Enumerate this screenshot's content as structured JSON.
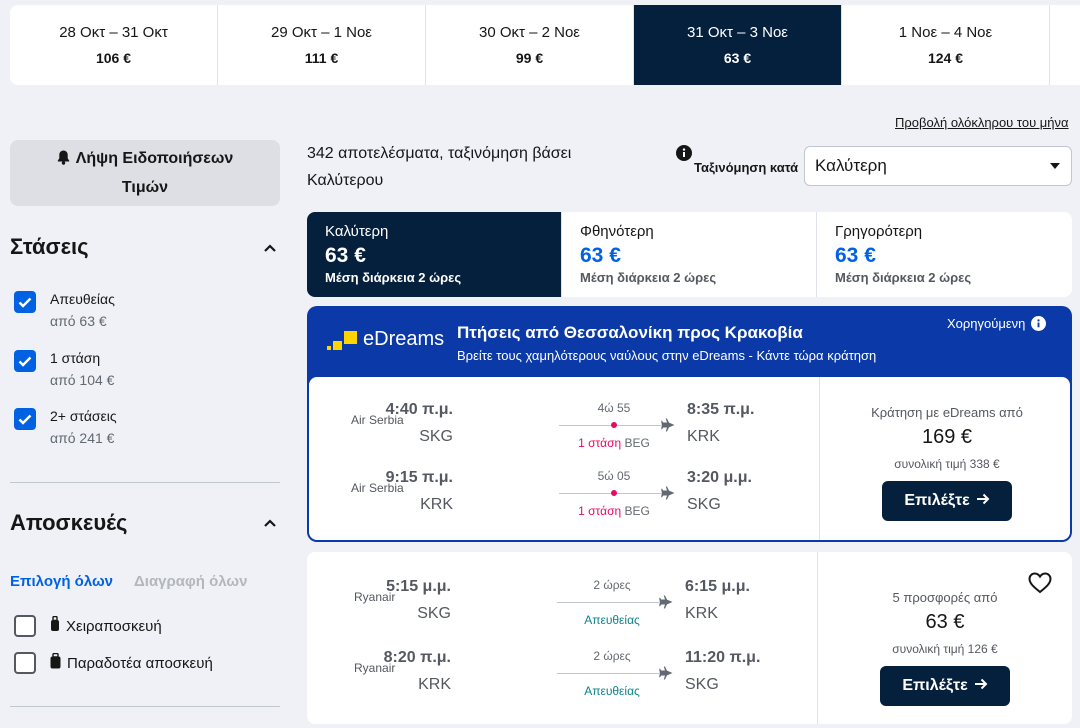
{
  "date_strip": [
    {
      "range": "28 Οκτ – 31 Οκτ",
      "price": "106 €"
    },
    {
      "range": "29 Οκτ – 1 Νοε",
      "price": "111 €"
    },
    {
      "range": "30 Οκτ – 2 Νοε",
      "price": "99 €"
    },
    {
      "range": "31 Οκτ – 3 Νοε",
      "price": "63 €"
    },
    {
      "range": "1 Νοε – 4 Νοε",
      "price": "124 €"
    }
  ],
  "month_link": "Προβολή ολόκληρου του μήνα",
  "sidebar": {
    "alert_line1": "Λήψη Ειδοποιήσεων",
    "alert_line2": "Τιμών",
    "stops_title": "Στάσεις",
    "stops": [
      {
        "label": "Απευθείας",
        "sub": "από 63 €"
      },
      {
        "label": "1 στάση",
        "sub": "από 104 €"
      },
      {
        "label": "2+ στάσεις",
        "sub": "από 241 €"
      }
    ],
    "bags_title": "Αποσκευές",
    "select_all": "Επιλογή όλων",
    "clear_all": "Διαγραφή όλων",
    "bags": [
      "Χειραποσκευή",
      "Παραδοτέα αποσκευή"
    ]
  },
  "results": {
    "count_line1": "342 αποτελέσματα, ταξινόμηση βάσει",
    "count_line2": "Καλύτερου",
    "sort_label": "Ταξινόμηση κατά",
    "sort_value": "Καλύτερη"
  },
  "sort_tabs": [
    {
      "title": "Καλύτερη",
      "price": "63 €",
      "duration": "Μέση διάρκεια 2 ώρες"
    },
    {
      "title": "Φθηνότερη",
      "price": "63 €",
      "duration": "Μέση διάρκεια 2 ώρες"
    },
    {
      "title": "Γρηγορότερη",
      "price": "63 €",
      "duration": "Μέση διάρκεια 2 ώρες"
    }
  ],
  "sponsored": {
    "brand": "eDreams",
    "title": "Πτήσεις από Θεσσαλονίκη προς Κρακοβία",
    "subtitle": "Βρείτε τους χαμηλότερους ναύλους στην eDreams - Κάντε τώρα κράτηση",
    "tag": "Χορηγούμενη",
    "legs": [
      {
        "airline": "Air Serbia",
        "dep_time": "4:40 π.μ.",
        "dep_airport": "SKG",
        "duration": "4ώ 55",
        "stops": "1 στάση",
        "via": "BEG",
        "arr_time": "8:35 π.μ.",
        "arr_airport": "KRK"
      },
      {
        "airline": "Air Serbia",
        "dep_time": "9:15 π.μ.",
        "dep_airport": "KRK",
        "duration": "5ώ 05",
        "stops": "1 στάση",
        "via": "BEG",
        "arr_time": "3:20 μ.μ.",
        "arr_airport": "SKG"
      }
    ],
    "price_label": "Κράτηση με eDreams από",
    "price": "169 €",
    "total": "συνολική τιμή 338 €",
    "button": "Επιλέξτε"
  },
  "result_card": {
    "legs": [
      {
        "airline": "Ryanair",
        "dep_time": "5:15 μ.μ.",
        "dep_airport": "SKG",
        "duration": "2 ώρες",
        "stops": "Απευθείας",
        "arr_time": "6:15 μ.μ.",
        "arr_airport": "KRK"
      },
      {
        "airline": "Ryanair",
        "dep_time": "8:20 π.μ.",
        "dep_airport": "KRK",
        "duration": "2 ώρες",
        "stops": "Απευθείας",
        "arr_time": "11:20 π.μ.",
        "arr_airport": "SKG"
      }
    ],
    "price_label": "5 προσφορές από",
    "price": "63 €",
    "total": "συνολική τιμή 126 €",
    "button": "Επιλέξτε"
  },
  "icons": {
    "bell": "bell-icon",
    "chevron": "chevron-up-icon",
    "info": "info-icon",
    "plane": "plane-icon",
    "heart": "heart-icon",
    "arrow": "arrow-right-icon",
    "bag": "luggage-icon"
  },
  "colors": {
    "primary_dark": "#05203c",
    "accent_blue": "#0062e3",
    "sponsor_blue": "#0b3aa8",
    "stop_red": "#e70866",
    "direct_teal": "#0c838a",
    "edreams_yellow": "#ffd400"
  }
}
